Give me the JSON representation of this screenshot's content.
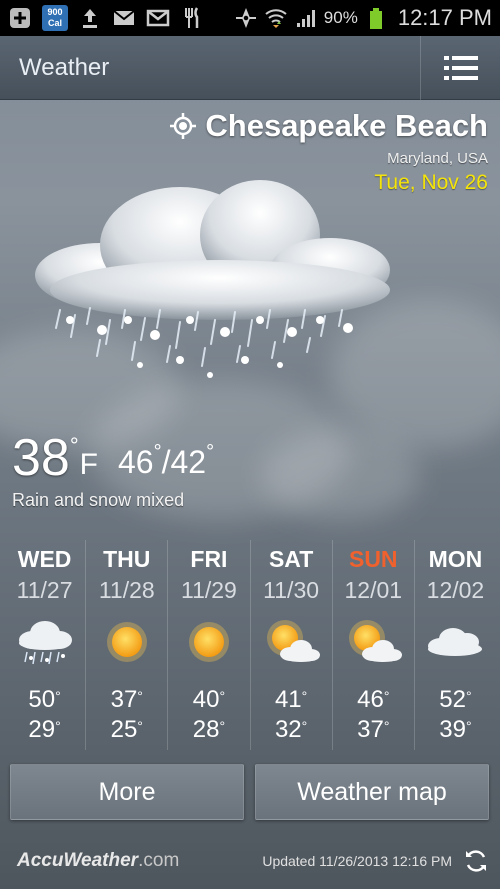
{
  "status_bar": {
    "calendar_badge": {
      "value": "900",
      "label": "Cal"
    },
    "battery_percent": "90%",
    "time": "12:17 PM",
    "icons": [
      "add-icon",
      "calendar-badge-icon",
      "upload-icon",
      "mail-icon",
      "gmail-icon",
      "restaurant-icon",
      "gps-icon",
      "wifi-icon",
      "signal-icon",
      "battery-icon"
    ]
  },
  "app_bar": {
    "title": "Weather",
    "menu_icon": "list-menu-icon"
  },
  "location": {
    "city": "Chesapeake Beach",
    "region": "Maryland, USA",
    "date": "Tue, Nov 26",
    "icon": "locate-icon"
  },
  "current": {
    "temp": "38",
    "unit": "F",
    "high": "46",
    "low": "42",
    "separator": "/",
    "degree": "°",
    "condition": "Rain and snow mixed",
    "icon": "rain-snow-cloud-icon"
  },
  "forecast": [
    {
      "day": "WED",
      "date": "11/27",
      "icon": "rain-snow-icon",
      "high": "50",
      "low": "29"
    },
    {
      "day": "THU",
      "date": "11/28",
      "icon": "sunny-icon",
      "high": "37",
      "low": "25"
    },
    {
      "day": "FRI",
      "date": "11/29",
      "icon": "sunny-icon",
      "high": "40",
      "low": "28"
    },
    {
      "day": "SAT",
      "date": "11/30",
      "icon": "partly-cloudy-icon",
      "high": "41",
      "low": "32"
    },
    {
      "day": "SUN",
      "date": "12/01",
      "icon": "partly-cloudy-icon",
      "high": "46",
      "low": "37"
    },
    {
      "day": "MON",
      "date": "12/02",
      "icon": "cloudy-icon",
      "high": "52",
      "low": "39"
    }
  ],
  "buttons": {
    "more": "More",
    "map": "Weather map"
  },
  "footer": {
    "logo_main": "AccuWeather",
    "logo_domain": ".com",
    "updated": "Updated 11/26/2013 12:16 PM",
    "refresh_icon": "refresh-icon"
  },
  "colors": {
    "sunday": "#f0612d",
    "date_yellow": "#f4e40a",
    "title_bar": "#4f5a65",
    "sun": "#f7a81a"
  }
}
